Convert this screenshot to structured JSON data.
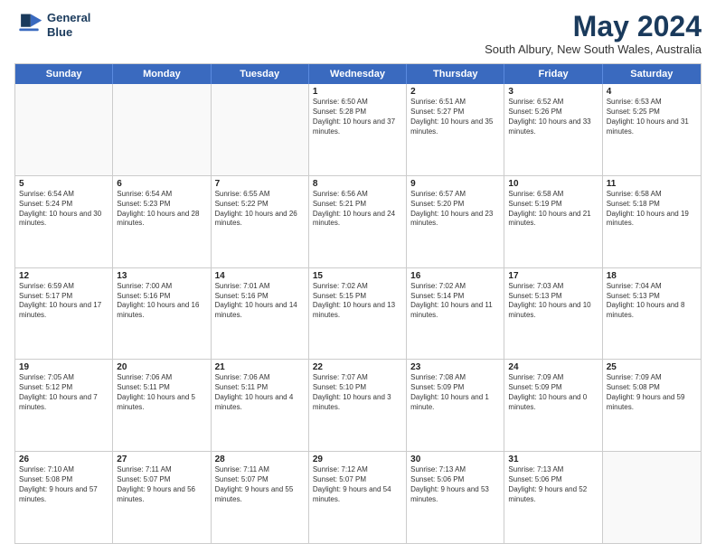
{
  "logo": {
    "line1": "General",
    "line2": "Blue"
  },
  "title": "May 2024",
  "subtitle": "South Albury, New South Wales, Australia",
  "header_days": [
    "Sunday",
    "Monday",
    "Tuesday",
    "Wednesday",
    "Thursday",
    "Friday",
    "Saturday"
  ],
  "weeks": [
    [
      {
        "day": "",
        "sunrise": "",
        "sunset": "",
        "daylight": ""
      },
      {
        "day": "",
        "sunrise": "",
        "sunset": "",
        "daylight": ""
      },
      {
        "day": "",
        "sunrise": "",
        "sunset": "",
        "daylight": ""
      },
      {
        "day": "1",
        "sunrise": "Sunrise: 6:50 AM",
        "sunset": "Sunset: 5:28 PM",
        "daylight": "Daylight: 10 hours and 37 minutes."
      },
      {
        "day": "2",
        "sunrise": "Sunrise: 6:51 AM",
        "sunset": "Sunset: 5:27 PM",
        "daylight": "Daylight: 10 hours and 35 minutes."
      },
      {
        "day": "3",
        "sunrise": "Sunrise: 6:52 AM",
        "sunset": "Sunset: 5:26 PM",
        "daylight": "Daylight: 10 hours and 33 minutes."
      },
      {
        "day": "4",
        "sunrise": "Sunrise: 6:53 AM",
        "sunset": "Sunset: 5:25 PM",
        "daylight": "Daylight: 10 hours and 31 minutes."
      }
    ],
    [
      {
        "day": "5",
        "sunrise": "Sunrise: 6:54 AM",
        "sunset": "Sunset: 5:24 PM",
        "daylight": "Daylight: 10 hours and 30 minutes."
      },
      {
        "day": "6",
        "sunrise": "Sunrise: 6:54 AM",
        "sunset": "Sunset: 5:23 PM",
        "daylight": "Daylight: 10 hours and 28 minutes."
      },
      {
        "day": "7",
        "sunrise": "Sunrise: 6:55 AM",
        "sunset": "Sunset: 5:22 PM",
        "daylight": "Daylight: 10 hours and 26 minutes."
      },
      {
        "day": "8",
        "sunrise": "Sunrise: 6:56 AM",
        "sunset": "Sunset: 5:21 PM",
        "daylight": "Daylight: 10 hours and 24 minutes."
      },
      {
        "day": "9",
        "sunrise": "Sunrise: 6:57 AM",
        "sunset": "Sunset: 5:20 PM",
        "daylight": "Daylight: 10 hours and 23 minutes."
      },
      {
        "day": "10",
        "sunrise": "Sunrise: 6:58 AM",
        "sunset": "Sunset: 5:19 PM",
        "daylight": "Daylight: 10 hours and 21 minutes."
      },
      {
        "day": "11",
        "sunrise": "Sunrise: 6:58 AM",
        "sunset": "Sunset: 5:18 PM",
        "daylight": "Daylight: 10 hours and 19 minutes."
      }
    ],
    [
      {
        "day": "12",
        "sunrise": "Sunrise: 6:59 AM",
        "sunset": "Sunset: 5:17 PM",
        "daylight": "Daylight: 10 hours and 17 minutes."
      },
      {
        "day": "13",
        "sunrise": "Sunrise: 7:00 AM",
        "sunset": "Sunset: 5:16 PM",
        "daylight": "Daylight: 10 hours and 16 minutes."
      },
      {
        "day": "14",
        "sunrise": "Sunrise: 7:01 AM",
        "sunset": "Sunset: 5:16 PM",
        "daylight": "Daylight: 10 hours and 14 minutes."
      },
      {
        "day": "15",
        "sunrise": "Sunrise: 7:02 AM",
        "sunset": "Sunset: 5:15 PM",
        "daylight": "Daylight: 10 hours and 13 minutes."
      },
      {
        "day": "16",
        "sunrise": "Sunrise: 7:02 AM",
        "sunset": "Sunset: 5:14 PM",
        "daylight": "Daylight: 10 hours and 11 minutes."
      },
      {
        "day": "17",
        "sunrise": "Sunrise: 7:03 AM",
        "sunset": "Sunset: 5:13 PM",
        "daylight": "Daylight: 10 hours and 10 minutes."
      },
      {
        "day": "18",
        "sunrise": "Sunrise: 7:04 AM",
        "sunset": "Sunset: 5:13 PM",
        "daylight": "Daylight: 10 hours and 8 minutes."
      }
    ],
    [
      {
        "day": "19",
        "sunrise": "Sunrise: 7:05 AM",
        "sunset": "Sunset: 5:12 PM",
        "daylight": "Daylight: 10 hours and 7 minutes."
      },
      {
        "day": "20",
        "sunrise": "Sunrise: 7:06 AM",
        "sunset": "Sunset: 5:11 PM",
        "daylight": "Daylight: 10 hours and 5 minutes."
      },
      {
        "day": "21",
        "sunrise": "Sunrise: 7:06 AM",
        "sunset": "Sunset: 5:11 PM",
        "daylight": "Daylight: 10 hours and 4 minutes."
      },
      {
        "day": "22",
        "sunrise": "Sunrise: 7:07 AM",
        "sunset": "Sunset: 5:10 PM",
        "daylight": "Daylight: 10 hours and 3 minutes."
      },
      {
        "day": "23",
        "sunrise": "Sunrise: 7:08 AM",
        "sunset": "Sunset: 5:09 PM",
        "daylight": "Daylight: 10 hours and 1 minute."
      },
      {
        "day": "24",
        "sunrise": "Sunrise: 7:09 AM",
        "sunset": "Sunset: 5:09 PM",
        "daylight": "Daylight: 10 hours and 0 minutes."
      },
      {
        "day": "25",
        "sunrise": "Sunrise: 7:09 AM",
        "sunset": "Sunset: 5:08 PM",
        "daylight": "Daylight: 9 hours and 59 minutes."
      }
    ],
    [
      {
        "day": "26",
        "sunrise": "Sunrise: 7:10 AM",
        "sunset": "Sunset: 5:08 PM",
        "daylight": "Daylight: 9 hours and 57 minutes."
      },
      {
        "day": "27",
        "sunrise": "Sunrise: 7:11 AM",
        "sunset": "Sunset: 5:07 PM",
        "daylight": "Daylight: 9 hours and 56 minutes."
      },
      {
        "day": "28",
        "sunrise": "Sunrise: 7:11 AM",
        "sunset": "Sunset: 5:07 PM",
        "daylight": "Daylight: 9 hours and 55 minutes."
      },
      {
        "day": "29",
        "sunrise": "Sunrise: 7:12 AM",
        "sunset": "Sunset: 5:07 PM",
        "daylight": "Daylight: 9 hours and 54 minutes."
      },
      {
        "day": "30",
        "sunrise": "Sunrise: 7:13 AM",
        "sunset": "Sunset: 5:06 PM",
        "daylight": "Daylight: 9 hours and 53 minutes."
      },
      {
        "day": "31",
        "sunrise": "Sunrise: 7:13 AM",
        "sunset": "Sunset: 5:06 PM",
        "daylight": "Daylight: 9 hours and 52 minutes."
      },
      {
        "day": "",
        "sunrise": "",
        "sunset": "",
        "daylight": ""
      }
    ]
  ]
}
